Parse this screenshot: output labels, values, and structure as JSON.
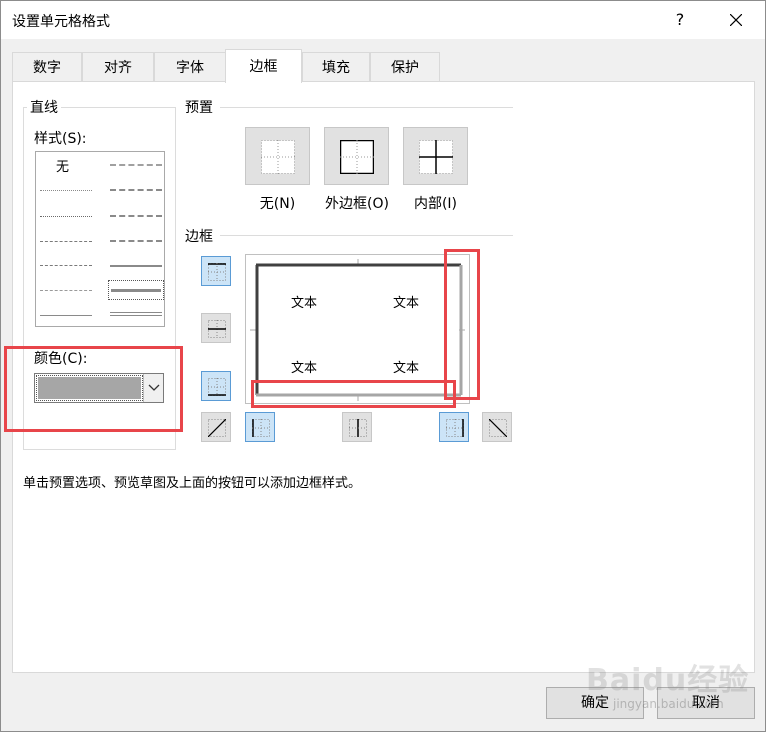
{
  "dialog": {
    "title": "设置单元格格式",
    "help_glyph": "?"
  },
  "tabs": [
    {
      "label": "数字"
    },
    {
      "label": "对齐"
    },
    {
      "label": "字体"
    },
    {
      "label": "边框"
    },
    {
      "label": "填充"
    },
    {
      "label": "保护"
    }
  ],
  "active_tab": "边框",
  "line_section": {
    "title": "直线",
    "style_label": "样式(S):",
    "style_none": "无",
    "color_label": "颜色(C):",
    "selected_color": "#a6a6a6"
  },
  "presets": {
    "title": "预置",
    "items": [
      {
        "label": "无(N)"
      },
      {
        "label": "外边框(O)"
      },
      {
        "label": "内部(I)"
      }
    ]
  },
  "border": {
    "title": "边框",
    "preview_texts": [
      "文本",
      "文本",
      "文本",
      "文本"
    ]
  },
  "hint": "单击预置选项、预览草图及上面的按钮可以添加边框样式。",
  "footer": {
    "ok_label": "确定",
    "cancel_label": "取消"
  },
  "watermark": {
    "text": "Baidu经验",
    "sub": "jingyan.baidu.com"
  },
  "colors": {
    "annotation": "#e8454a",
    "selected_button": "#cce4f7"
  }
}
